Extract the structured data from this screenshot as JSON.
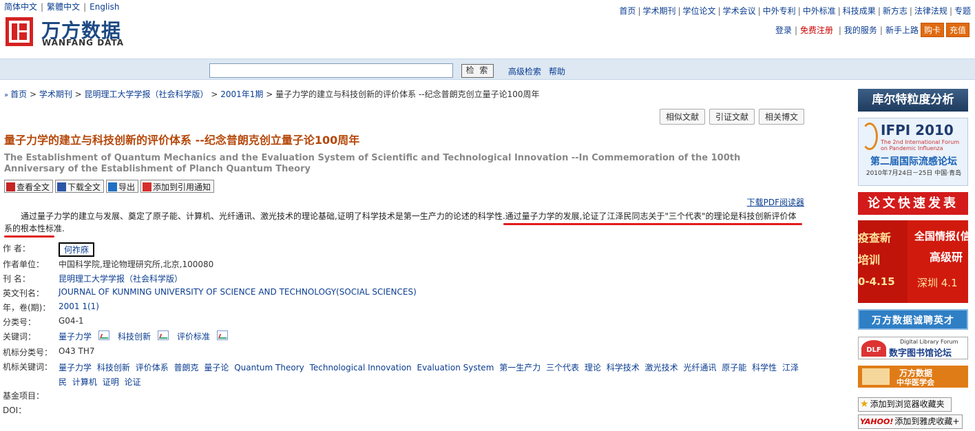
{
  "languages": [
    "简体中文",
    "繁體中文",
    "English"
  ],
  "logo": {
    "cn": "万方数据",
    "en": "WANFANG DATA"
  },
  "top_nav": [
    "首页",
    "学术期刊",
    "学位论文",
    "学术会议",
    "中外专利",
    "中外标准",
    "科技成果",
    "新方志",
    "法律法规",
    "专题"
  ],
  "user_nav": {
    "login": "登录",
    "register": "免费注册",
    "services": "我的服务",
    "guide": "新手上路",
    "buy": "购卡",
    "recharge": "充值"
  },
  "search": {
    "value": "",
    "button": "检 索",
    "advanced": "高级检索",
    "help": "帮助"
  },
  "breadcrumb": [
    "首页",
    "学术期刊",
    "昆明理工大学学报（社会科学版）",
    "2001年1期",
    "量子力学的建立与科技创新的评价体系 --纪念普朗克创立量子论100周年"
  ],
  "related_buttons": [
    "相似文献",
    "引证文献",
    "相关博文"
  ],
  "title_cn": "量子力学的建立与科技创新的评价体系 --纪念普朗克创立量子论100周年",
  "title_en": "The Establishment of Quantum Mechanics and the Evaluation System of Scientific and Technological Innovation --In Commemoration of the 100th Anniversary of the Establishment of Planch Quantum Theory",
  "actions": [
    "查看全文",
    "下载全文",
    "导出",
    "添加到引用通知"
  ],
  "pdf_reader": "下载PDF阅读器",
  "abstract": "通过量子力学的建立与发展、奠定了原子能、计算机、光纤通讯、激光技术的理论基础,证明了科学技术是第一生产力的论述的科学性.通过量子力学的发展,论证了江泽民同志关于\"三个代表\"的理论是科技创新评价体系的根本性标准.",
  "meta": {
    "author_label": "作 者：",
    "author": "何祚庥",
    "unit_label": "作者单位：",
    "unit": "中国科学院,理论物理研究所,北京,100080",
    "journal_label": "刊 名：",
    "journal": "昆明理工大学学报（社会科学版）",
    "journal_en_label": "英文刊名：",
    "journal_en": "JOURNAL OF KUNMING UNIVERSITY OF SCIENCE AND TECHNOLOGY(SOCIAL SCIENCES)",
    "issue_label": "年，卷(期)：",
    "issue": "2001 1(1)",
    "class_label": "分类号：",
    "class": "G04-1",
    "keywords_label": "关键词：",
    "keywords": [
      "量子力学",
      "科技创新",
      "评价标准"
    ],
    "mach_class_label": "机标分类号：",
    "mach_class": "O43 TH7",
    "mach_kw_label": "机标关键词：",
    "mach_keywords": [
      "量子力学",
      "科技创新",
      "评价体系",
      "普朗克",
      "量子论",
      "Quantum Theory",
      "Technological Innovation",
      "Evaluation System",
      "第一生产力",
      "三个代表",
      "理论",
      "科学技术",
      "激光技术",
      "光纤通讯",
      "原子能",
      "科学性",
      "江泽民",
      "计算机",
      "证明",
      "论证"
    ],
    "fund_label": "基金项目：",
    "doi_label": "DOI："
  },
  "sidebar": {
    "kurt": "库尔特粒度分析",
    "ifpi_title": "IFPI 2010",
    "ifpi_sub": "The 2nd International Forum on Pandemic Influenza",
    "ifpi_cn": "第二届国际流感论坛",
    "ifpi_date": "2010年7月24日－25日 中国·青岛",
    "lunwen": "论文快速发表",
    "train_l1": "疫查新",
    "train_l2": "培训",
    "train_l3": "0-4.15",
    "train_r1": "全国情报(信",
    "train_r2": "高级研",
    "train_r3": "深圳 4.1",
    "recruit": "万方数据诚聘英才",
    "dlf_small": "Digital Library Forum",
    "dlf": "数字图书馆论坛",
    "med1": "万方数据",
    "med2": "中华医学会",
    "fav_browser": "添加到浏览器收藏夹",
    "fav_yahoo_brand": "YAHOO!",
    "fav_yahoo": "添加到雅虎收藏+"
  }
}
